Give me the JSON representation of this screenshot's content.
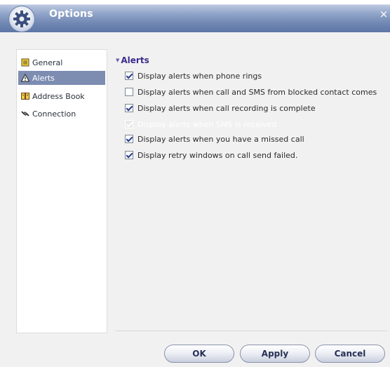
{
  "window": {
    "title": "Options",
    "close_glyph": "×"
  },
  "sidebar": {
    "items": [
      {
        "label": "General",
        "icon": "general-icon",
        "selected": false
      },
      {
        "label": "Alerts",
        "icon": "alert-triangle-icon",
        "selected": true
      },
      {
        "label": "Address Book",
        "icon": "address-book-icon",
        "selected": false
      },
      {
        "label": "Connection",
        "icon": "connection-icon",
        "selected": false
      }
    ]
  },
  "alerts": {
    "title": "Alerts",
    "options": [
      {
        "label": "Display alerts when phone rings",
        "checked": true,
        "enabled": true
      },
      {
        "label": "Display alerts when call and SMS from blocked contact comes",
        "checked": false,
        "enabled": true
      },
      {
        "label": "Display alerts when call recording is complete",
        "checked": true,
        "enabled": true
      },
      {
        "label": "Display alerts when SMS is received",
        "checked": true,
        "enabled": false
      },
      {
        "label": "Display alerts when you have a missed call",
        "checked": true,
        "enabled": true
      },
      {
        "label": "Display retry windows on call send failed.",
        "checked": true,
        "enabled": true
      }
    ]
  },
  "buttons": {
    "ok": "OK",
    "apply": "Apply",
    "cancel": "Cancel"
  },
  "colors": {
    "accent": "#7d8cb1",
    "titlebar": "#6f86b2",
    "section_title": "#3a2c8c"
  }
}
